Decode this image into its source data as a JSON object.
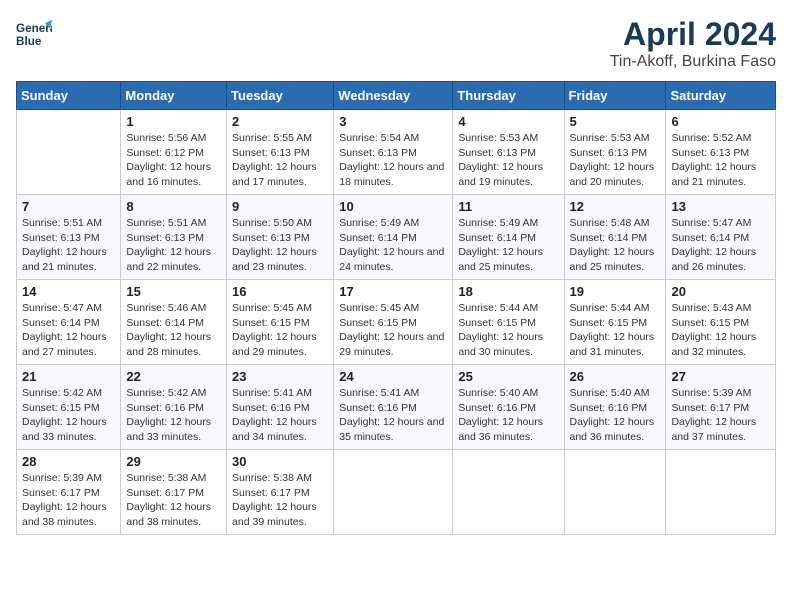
{
  "header": {
    "logo_line1": "General",
    "logo_line2": "Blue",
    "month": "April 2024",
    "location": "Tin-Akoff, Burkina Faso"
  },
  "days_of_week": [
    "Sunday",
    "Monday",
    "Tuesday",
    "Wednesday",
    "Thursday",
    "Friday",
    "Saturday"
  ],
  "weeks": [
    [
      {
        "day": "",
        "sunrise": "",
        "sunset": "",
        "daylight": ""
      },
      {
        "day": "1",
        "sunrise": "Sunrise: 5:56 AM",
        "sunset": "Sunset: 6:12 PM",
        "daylight": "Daylight: 12 hours and 16 minutes."
      },
      {
        "day": "2",
        "sunrise": "Sunrise: 5:55 AM",
        "sunset": "Sunset: 6:13 PM",
        "daylight": "Daylight: 12 hours and 17 minutes."
      },
      {
        "day": "3",
        "sunrise": "Sunrise: 5:54 AM",
        "sunset": "Sunset: 6:13 PM",
        "daylight": "Daylight: 12 hours and 18 minutes."
      },
      {
        "day": "4",
        "sunrise": "Sunrise: 5:53 AM",
        "sunset": "Sunset: 6:13 PM",
        "daylight": "Daylight: 12 hours and 19 minutes."
      },
      {
        "day": "5",
        "sunrise": "Sunrise: 5:53 AM",
        "sunset": "Sunset: 6:13 PM",
        "daylight": "Daylight: 12 hours and 20 minutes."
      },
      {
        "day": "6",
        "sunrise": "Sunrise: 5:52 AM",
        "sunset": "Sunset: 6:13 PM",
        "daylight": "Daylight: 12 hours and 21 minutes."
      }
    ],
    [
      {
        "day": "7",
        "sunrise": "Sunrise: 5:51 AM",
        "sunset": "Sunset: 6:13 PM",
        "daylight": "Daylight: 12 hours and 21 minutes."
      },
      {
        "day": "8",
        "sunrise": "Sunrise: 5:51 AM",
        "sunset": "Sunset: 6:13 PM",
        "daylight": "Daylight: 12 hours and 22 minutes."
      },
      {
        "day": "9",
        "sunrise": "Sunrise: 5:50 AM",
        "sunset": "Sunset: 6:13 PM",
        "daylight": "Daylight: 12 hours and 23 minutes."
      },
      {
        "day": "10",
        "sunrise": "Sunrise: 5:49 AM",
        "sunset": "Sunset: 6:14 PM",
        "daylight": "Daylight: 12 hours and 24 minutes."
      },
      {
        "day": "11",
        "sunrise": "Sunrise: 5:49 AM",
        "sunset": "Sunset: 6:14 PM",
        "daylight": "Daylight: 12 hours and 25 minutes."
      },
      {
        "day": "12",
        "sunrise": "Sunrise: 5:48 AM",
        "sunset": "Sunset: 6:14 PM",
        "daylight": "Daylight: 12 hours and 25 minutes."
      },
      {
        "day": "13",
        "sunrise": "Sunrise: 5:47 AM",
        "sunset": "Sunset: 6:14 PM",
        "daylight": "Daylight: 12 hours and 26 minutes."
      }
    ],
    [
      {
        "day": "14",
        "sunrise": "Sunrise: 5:47 AM",
        "sunset": "Sunset: 6:14 PM",
        "daylight": "Daylight: 12 hours and 27 minutes."
      },
      {
        "day": "15",
        "sunrise": "Sunrise: 5:46 AM",
        "sunset": "Sunset: 6:14 PM",
        "daylight": "Daylight: 12 hours and 28 minutes."
      },
      {
        "day": "16",
        "sunrise": "Sunrise: 5:45 AM",
        "sunset": "Sunset: 6:15 PM",
        "daylight": "Daylight: 12 hours and 29 minutes."
      },
      {
        "day": "17",
        "sunrise": "Sunrise: 5:45 AM",
        "sunset": "Sunset: 6:15 PM",
        "daylight": "Daylight: 12 hours and 29 minutes."
      },
      {
        "day": "18",
        "sunrise": "Sunrise: 5:44 AM",
        "sunset": "Sunset: 6:15 PM",
        "daylight": "Daylight: 12 hours and 30 minutes."
      },
      {
        "day": "19",
        "sunrise": "Sunrise: 5:44 AM",
        "sunset": "Sunset: 6:15 PM",
        "daylight": "Daylight: 12 hours and 31 minutes."
      },
      {
        "day": "20",
        "sunrise": "Sunrise: 5:43 AM",
        "sunset": "Sunset: 6:15 PM",
        "daylight": "Daylight: 12 hours and 32 minutes."
      }
    ],
    [
      {
        "day": "21",
        "sunrise": "Sunrise: 5:42 AM",
        "sunset": "Sunset: 6:15 PM",
        "daylight": "Daylight: 12 hours and 33 minutes."
      },
      {
        "day": "22",
        "sunrise": "Sunrise: 5:42 AM",
        "sunset": "Sunset: 6:16 PM",
        "daylight": "Daylight: 12 hours and 33 minutes."
      },
      {
        "day": "23",
        "sunrise": "Sunrise: 5:41 AM",
        "sunset": "Sunset: 6:16 PM",
        "daylight": "Daylight: 12 hours and 34 minutes."
      },
      {
        "day": "24",
        "sunrise": "Sunrise: 5:41 AM",
        "sunset": "Sunset: 6:16 PM",
        "daylight": "Daylight: 12 hours and 35 minutes."
      },
      {
        "day": "25",
        "sunrise": "Sunrise: 5:40 AM",
        "sunset": "Sunset: 6:16 PM",
        "daylight": "Daylight: 12 hours and 36 minutes."
      },
      {
        "day": "26",
        "sunrise": "Sunrise: 5:40 AM",
        "sunset": "Sunset: 6:16 PM",
        "daylight": "Daylight: 12 hours and 36 minutes."
      },
      {
        "day": "27",
        "sunrise": "Sunrise: 5:39 AM",
        "sunset": "Sunset: 6:17 PM",
        "daylight": "Daylight: 12 hours and 37 minutes."
      }
    ],
    [
      {
        "day": "28",
        "sunrise": "Sunrise: 5:39 AM",
        "sunset": "Sunset: 6:17 PM",
        "daylight": "Daylight: 12 hours and 38 minutes."
      },
      {
        "day": "29",
        "sunrise": "Sunrise: 5:38 AM",
        "sunset": "Sunset: 6:17 PM",
        "daylight": "Daylight: 12 hours and 38 minutes."
      },
      {
        "day": "30",
        "sunrise": "Sunrise: 5:38 AM",
        "sunset": "Sunset: 6:17 PM",
        "daylight": "Daylight: 12 hours and 39 minutes."
      },
      {
        "day": "",
        "sunrise": "",
        "sunset": "",
        "daylight": ""
      },
      {
        "day": "",
        "sunrise": "",
        "sunset": "",
        "daylight": ""
      },
      {
        "day": "",
        "sunrise": "",
        "sunset": "",
        "daylight": ""
      },
      {
        "day": "",
        "sunrise": "",
        "sunset": "",
        "daylight": ""
      }
    ]
  ]
}
